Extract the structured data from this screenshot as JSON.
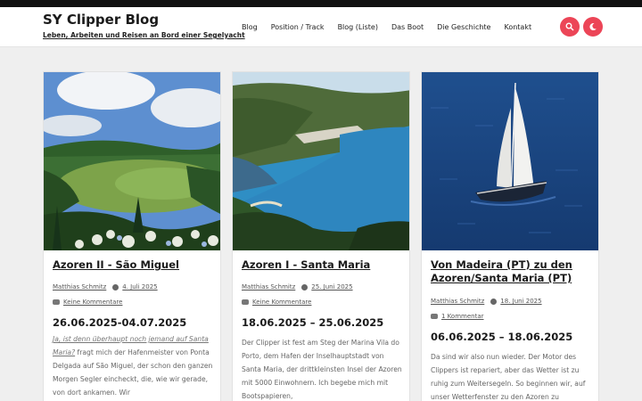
{
  "site": {
    "title": "SY Clipper Blog",
    "tagline": "Leben, Arbeiten und Reisen an Bord einer Segelyacht"
  },
  "nav": {
    "items": [
      {
        "label": "Blog"
      },
      {
        "label": "Position / Track"
      },
      {
        "label": "Blog (Liste)"
      },
      {
        "label": "Das Boot"
      },
      {
        "label": "Die Geschichte"
      },
      {
        "label": "Kontakt"
      }
    ]
  },
  "header_buttons": {
    "search_icon": "search-icon",
    "theme_icon": "moon-icon",
    "accent_color": "#ec4557"
  },
  "posts": [
    {
      "title": "Azoren II - São Miguel",
      "author": "Matthias Schmitz",
      "date": "4. Juli 2025",
      "comments": "Keine Kommentare",
      "dates": "26.06.2025-04.07.2025",
      "excerpt_quote": "Ja, ist denn überhaupt noch jemand auf Santa Maria?",
      "excerpt": "fragt mich der Hafenmeister von Ponta Delgada auf São Miguel, der schon den ganzen Morgen Segler eincheckt, die, wie wir gerade, von dort ankamen. Wir"
    },
    {
      "title": "Azoren I - Santa Maria",
      "author": "Matthias Schmitz",
      "date": "25. Juni 2025",
      "comments": "Keine Kommentare",
      "dates": "18.06.2025 – 25.06.2025",
      "excerpt": "Der Clipper ist fest am Steg der Marina Vila do Porto, dem Hafen der Inselhauptstadt von Santa Maria, der drittkleinsten Insel der Azoren mit 5000 Einwohnern. Ich begebe mich mit Bootspapieren,"
    },
    {
      "title": "Von Madeira (PT) zu den Azoren/Santa Maria (PT)",
      "author": "Matthias Schmitz",
      "date": "18. Juni 2025",
      "comments": "1 Kommentar",
      "dates": "06.06.2025 – 18.06.2025",
      "excerpt": "Da sind wir also nun wieder. Der Motor des Clippers ist repariert, aber das Wetter ist zu ruhig zum Weitersegeln. So beginnen wir, auf unser Wetterfenster zu den Azoren zu"
    }
  ]
}
